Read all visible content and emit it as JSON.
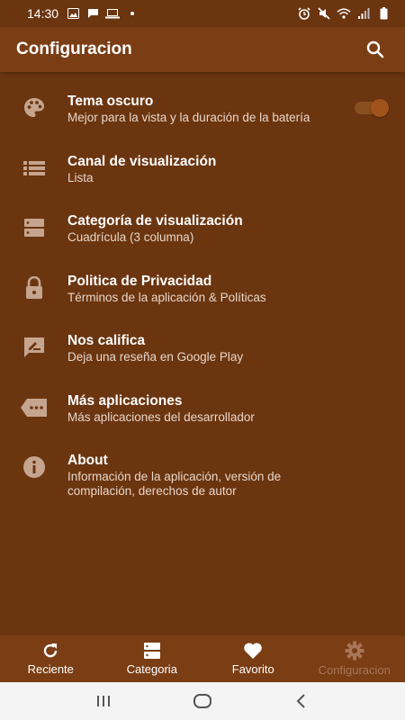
{
  "status_bar": {
    "time": "14:30",
    "left_icons": [
      "image-icon",
      "message-icon",
      "laptop-icon",
      "dot-icon"
    ],
    "right_icons": [
      "alarm-icon",
      "mute-icon",
      "wifi-icon",
      "signal-icon",
      "battery-icon"
    ]
  },
  "app_bar": {
    "title": "Configuracion",
    "search_icon": "search-icon"
  },
  "settings": [
    {
      "icon": "palette-icon",
      "title": "Tema oscuro",
      "subtitle": "Mejor para la vista y la duración de la batería",
      "toggle": true
    },
    {
      "icon": "list-icon",
      "title": "Canal de visualización",
      "subtitle": "Lista"
    },
    {
      "icon": "grid-icon",
      "title": "Categoría de visualización",
      "subtitle": "Cuadrícula (3 columna)"
    },
    {
      "icon": "lock-icon",
      "title": "Politica de Privacidad",
      "subtitle": "Términos de la aplicación & Políticas"
    },
    {
      "icon": "rate-review-icon",
      "title": "Nos califica",
      "subtitle": "Deja una reseña en Google Play"
    },
    {
      "icon": "more-apps-icon",
      "title": "Más aplicaciones",
      "subtitle": "Más aplicaciones del desarrollador"
    },
    {
      "icon": "info-icon",
      "title": "About",
      "subtitle_line1": "Información de la aplicación, versión de",
      "subtitle_line2": "compilación, derechos de autor"
    }
  ],
  "bottom_nav": [
    {
      "icon": "refresh-icon",
      "label": "Reciente",
      "active": false
    },
    {
      "icon": "category-icon",
      "label": "Categoria",
      "active": false
    },
    {
      "icon": "heart-icon",
      "label": "Favorito",
      "active": false
    },
    {
      "icon": "settings-icon",
      "label": "Configuracion",
      "active": true
    }
  ],
  "system_nav": [
    "recents-icon",
    "home-icon",
    "back-icon"
  ],
  "colors": {
    "background": "#6b3510",
    "app_bar": "#7a3d14",
    "icon_muted": "#c6a58f",
    "active_nav": "#a87658",
    "toggle_track": "#8a4f1e",
    "toggle_knob": "#a0531a"
  }
}
